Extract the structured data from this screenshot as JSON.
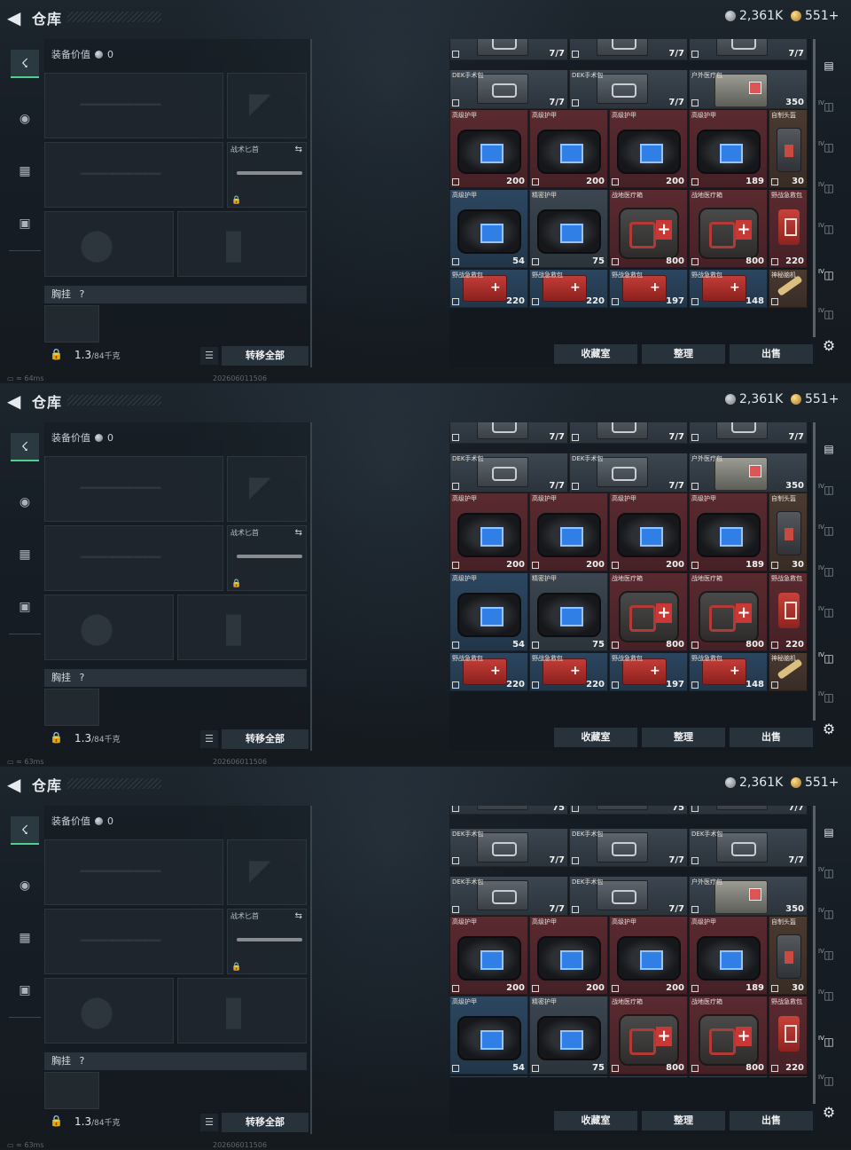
{
  "header": {
    "title": "仓库",
    "silver": "2,361K",
    "gold": "551+"
  },
  "equipment": {
    "value_label": "装备价值",
    "value": "0",
    "knife_label": "战术匕首",
    "chest_label": "胸挂",
    "chest_help": "?",
    "weight_value": "1.3",
    "weight_max": "/84千克",
    "transfer_all": "转移全部"
  },
  "inventory": {
    "top_row_a": [
      {
        "name": "DEK手术包",
        "value": "7/7"
      },
      {
        "name": "DEK手术包",
        "value": "7/7"
      },
      {
        "name": "DEK手术包",
        "value": "7/7"
      }
    ],
    "top_row_b": [
      {
        "name": "DEK手术包",
        "value": "7/7"
      },
      {
        "name": "DEK手术包",
        "value": "7/7"
      },
      {
        "name": "户外医疗包",
        "value": "350"
      }
    ],
    "armor_row": [
      {
        "name": "高级护甲",
        "value": "200"
      },
      {
        "name": "高级护甲",
        "value": "200"
      },
      {
        "name": "高级护甲",
        "value": "200"
      },
      {
        "name": "高级护甲",
        "value": "189"
      },
      {
        "name": "自制头盔",
        "value": "30"
      }
    ],
    "mid_row": [
      {
        "name": "高级护甲",
        "value": "54"
      },
      {
        "name": "精密护甲",
        "value": "75"
      },
      {
        "name": "战地医疗箱",
        "value": "800"
      },
      {
        "name": "战地医疗箱",
        "value": "800"
      },
      {
        "name": "野战急救包",
        "value": "220"
      }
    ],
    "kit_row": [
      {
        "name": "野战急救包",
        "value": "220"
      },
      {
        "name": "野战急救包",
        "value": "220"
      },
      {
        "name": "野战急救包",
        "value": "197"
      },
      {
        "name": "野战急救包",
        "value": "148"
      },
      {
        "name": "神秘脑机",
        "value": ""
      }
    ],
    "extra_row_top": [
      {
        "value": "75"
      },
      {
        "value": "75"
      },
      {
        "value": "7/7"
      }
    ],
    "actions": {
      "collection": "收藏室",
      "sort": "整理",
      "sell": "出售"
    }
  },
  "frames": [
    {
      "ping": "64ms",
      "stamp": "202606011506"
    },
    {
      "ping": "63ms",
      "stamp": "202606011506"
    },
    {
      "ping": "63ms",
      "stamp": "202606011506"
    }
  ],
  "sidebar_right": {
    "badges": [
      "IV",
      "IV",
      "IV",
      "IV",
      "IV",
      "IV"
    ]
  }
}
